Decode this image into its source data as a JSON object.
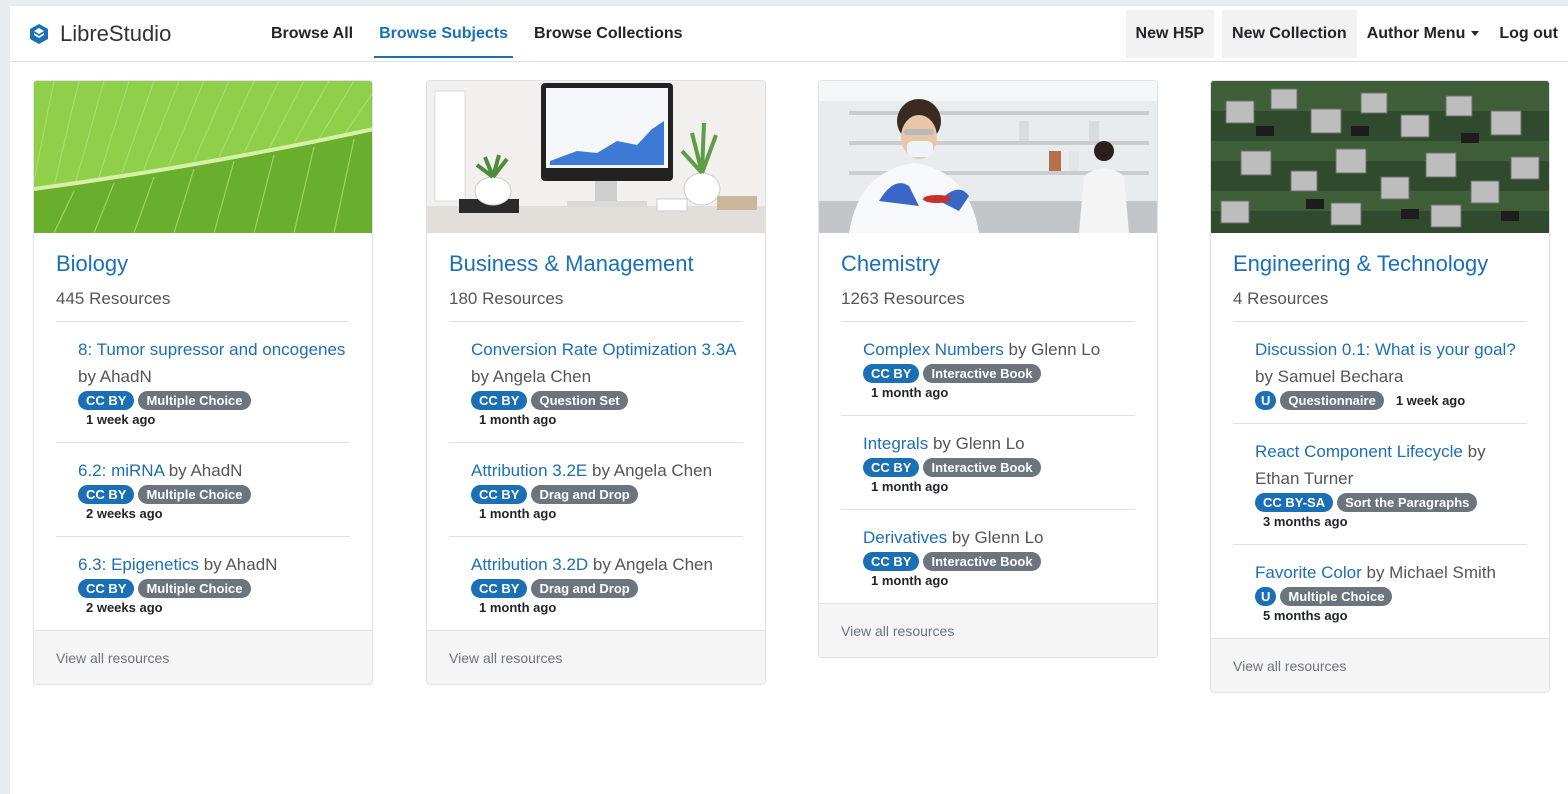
{
  "brand": {
    "name": "LibreStudio",
    "icon": "librestudio-logo-icon"
  },
  "nav": {
    "browse_all": "Browse All",
    "browse_subjects": "Browse Subjects",
    "browse_collections": "Browse Collections",
    "new_h5p": "New H5P",
    "new_collection": "New Collection",
    "author_menu": "Author Menu",
    "log_out": "Log out"
  },
  "colors": {
    "accent": "#1b6fb5",
    "badge_gray": "#6c757d"
  },
  "view_all_label": "View all resources",
  "subjects": [
    {
      "title": "Biology",
      "count": "445 Resources",
      "resources": [
        {
          "title": "8: Tumor supressor and oncogenes",
          "by": "by AhadN",
          "license": "CC BY",
          "type": "Multiple Choice",
          "time": "1 week ago"
        },
        {
          "title": "6.2: miRNA",
          "by": "by AhadN",
          "license": "CC BY",
          "type": "Multiple Choice",
          "time": "2 weeks ago"
        },
        {
          "title": "6.3: Epigenetics",
          "by": "by AhadN",
          "license": "CC BY",
          "type": "Multiple Choice",
          "time": "2 weeks ago"
        }
      ]
    },
    {
      "title": "Business & Management",
      "count": "180 Resources",
      "resources": [
        {
          "title": "Conversion Rate Optimization 3.3A",
          "by": "by Angela Chen",
          "license": "CC BY",
          "type": "Question Set",
          "time": "1 month ago"
        },
        {
          "title": "Attribution 3.2E",
          "by": "by Angela Chen",
          "license": "CC BY",
          "type": "Drag and Drop",
          "time": "1 month ago"
        },
        {
          "title": "Attribution 3.2D",
          "by": "by Angela Chen",
          "license": "CC BY",
          "type": "Drag and Drop",
          "time": "1 month ago"
        }
      ]
    },
    {
      "title": "Chemistry",
      "count": "1263 Resources",
      "resources": [
        {
          "title": "Complex Numbers",
          "by": "by Glenn Lo",
          "license": "CC BY",
          "type": "Interactive Book",
          "time": "1 month ago"
        },
        {
          "title": "Integrals",
          "by": "by Glenn Lo",
          "license": "CC BY",
          "type": "Interactive Book",
          "time": "1 month ago"
        },
        {
          "title": "Derivatives",
          "by": "by Glenn Lo",
          "license": "CC BY",
          "type": "Interactive Book",
          "time": "1 month ago"
        }
      ]
    },
    {
      "title": "Engineering & Technology",
      "count": "4 Resources",
      "resources": [
        {
          "title": "Discussion 0.1: What is your goal?",
          "by": "by Samuel Bechara",
          "license": "U",
          "type": "Questionnaire",
          "time": "1 week ago"
        },
        {
          "title": "React Component Lifecycle",
          "by": "by Ethan Turner",
          "license": "CC BY-SA",
          "type": "Sort the Paragraphs",
          "time": "3 months ago"
        },
        {
          "title": "Favorite Color",
          "by": "by Michael Smith",
          "license": "U",
          "type": "Multiple Choice",
          "time": "5 months ago"
        }
      ]
    }
  ]
}
